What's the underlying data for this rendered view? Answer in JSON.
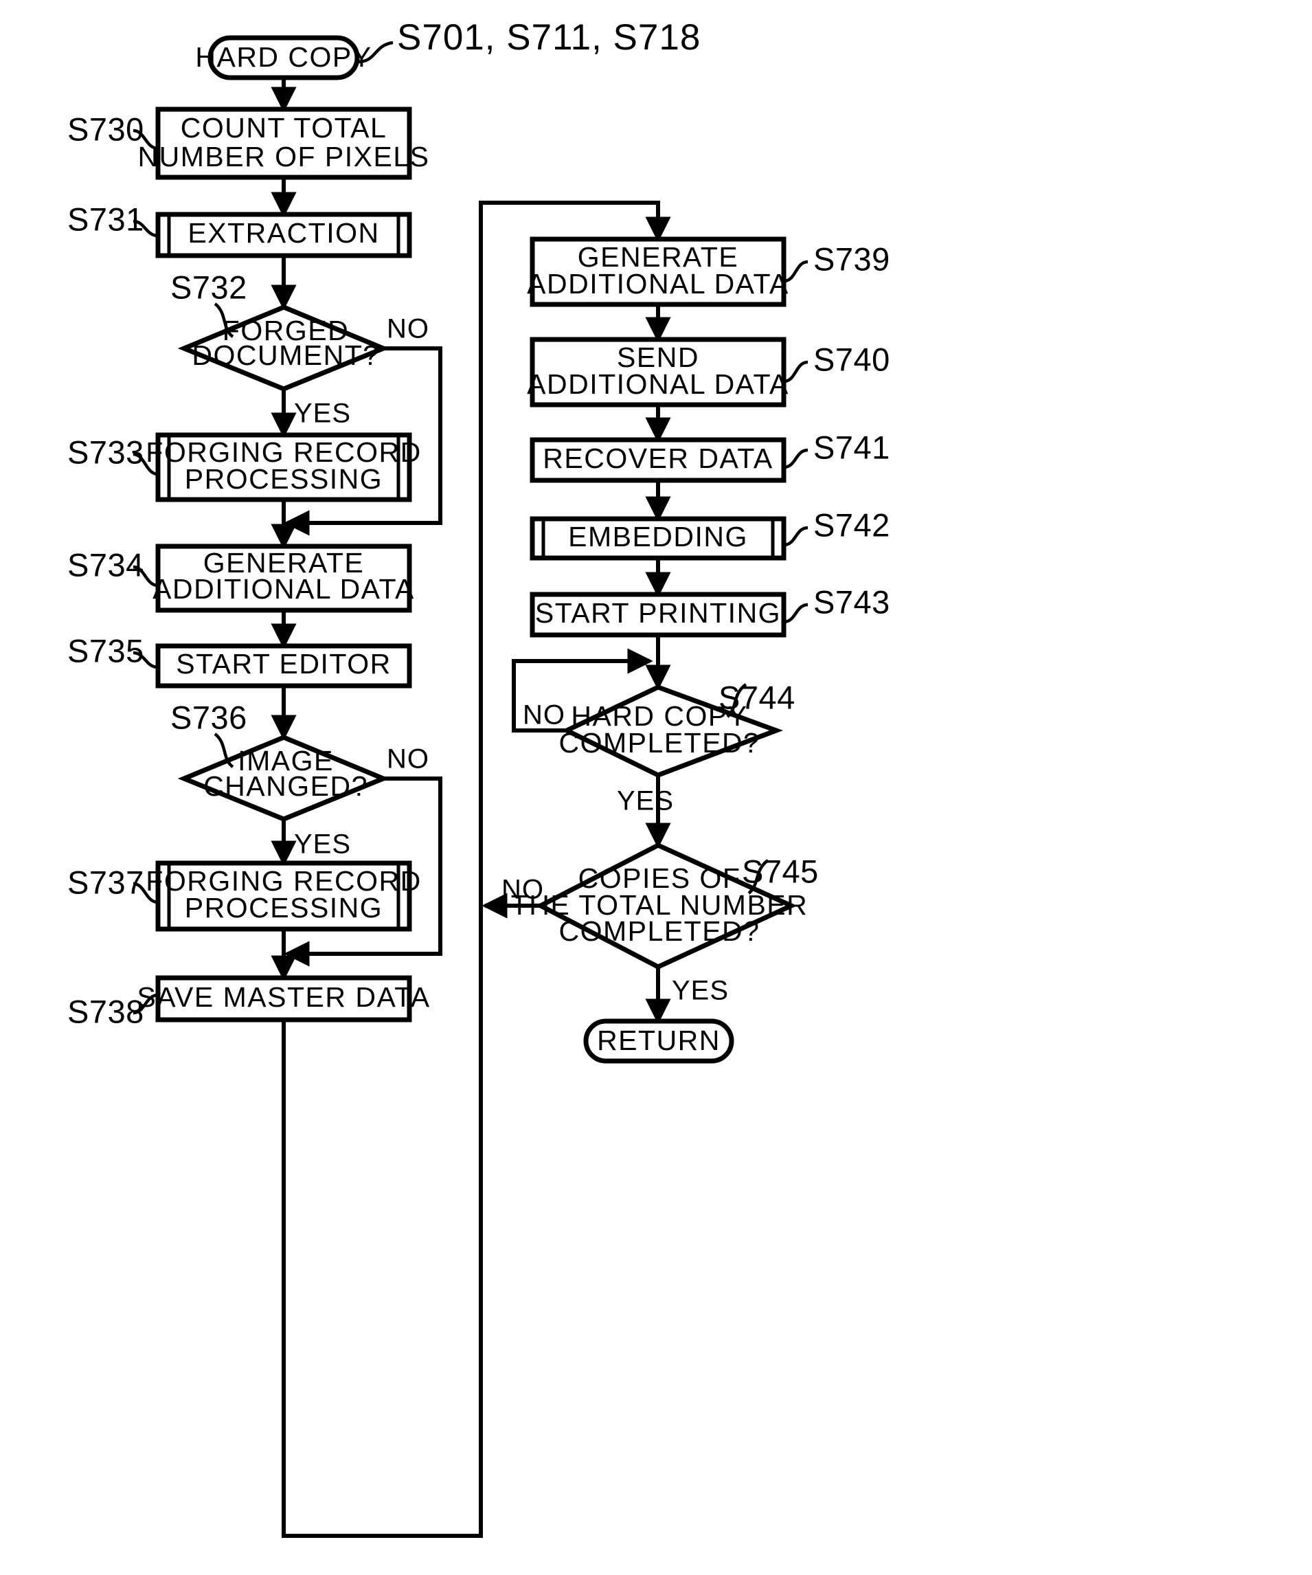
{
  "figure": {
    "type": "flowchart",
    "top_label": "S701, S711, S718"
  },
  "nodes": {
    "start": {
      "step": "",
      "label": "HARD COPY",
      "shape": "terminator"
    },
    "s730": {
      "step": "S730",
      "label_line1": "COUNT TOTAL",
      "label_line2": "NUMBER OF PIXELS",
      "shape": "process"
    },
    "s731": {
      "step": "S731",
      "label": "EXTRACTION",
      "shape": "predefined-process"
    },
    "s732": {
      "step": "S732",
      "label_line1": "FORGED",
      "label_line2": "DOCUMENT?",
      "shape": "decision",
      "yes": "YES",
      "no": "NO"
    },
    "s733": {
      "step": "S733",
      "label_line1": "FORGING RECORD",
      "label_line2": "PROCESSING",
      "shape": "predefined-process"
    },
    "s734": {
      "step": "S734",
      "label_line1": "GENERATE",
      "label_line2": "ADDITIONAL DATA",
      "shape": "process"
    },
    "s735": {
      "step": "S735",
      "label": "START EDITOR",
      "shape": "process"
    },
    "s736": {
      "step": "S736",
      "label_line1": "IMAGE",
      "label_line2": "CHANGED?",
      "shape": "decision",
      "yes": "YES",
      "no": "NO"
    },
    "s737": {
      "step": "S737",
      "label_line1": "FORGING RECORD",
      "label_line2": "PROCESSING",
      "shape": "predefined-process"
    },
    "s738": {
      "step": "S738",
      "label": "SAVE MASTER DATA",
      "shape": "process"
    },
    "s739": {
      "step": "S739",
      "label_line1": "GENERATE",
      "label_line2": "ADDITIONAL DATA",
      "shape": "process"
    },
    "s740": {
      "step": "S740",
      "label_line1": "SEND",
      "label_line2": "ADDITIONAL DATA",
      "shape": "process"
    },
    "s741": {
      "step": "S741",
      "label": "RECOVER DATA",
      "shape": "process"
    },
    "s742": {
      "step": "S742",
      "label": "EMBEDDING",
      "shape": "predefined-process"
    },
    "s743": {
      "step": "S743",
      "label": "START PRINTING",
      "shape": "process"
    },
    "s744": {
      "step": "S744",
      "label_line1": "HARD COPY",
      "label_line2": "COMPLETED?",
      "shape": "decision",
      "yes": "YES",
      "no": "NO"
    },
    "s745": {
      "step": "S745",
      "label_line1": "COPIES OF",
      "label_line2": "THE TOTAL NUMBER",
      "label_line3": "COMPLETED?",
      "shape": "decision",
      "yes": "YES",
      "no": "NO"
    },
    "return": {
      "step": "",
      "label": "RETURN",
      "shape": "terminator"
    }
  },
  "colors": {
    "line": "#000000",
    "fill": "#ffffff",
    "background": "#ffffff"
  }
}
